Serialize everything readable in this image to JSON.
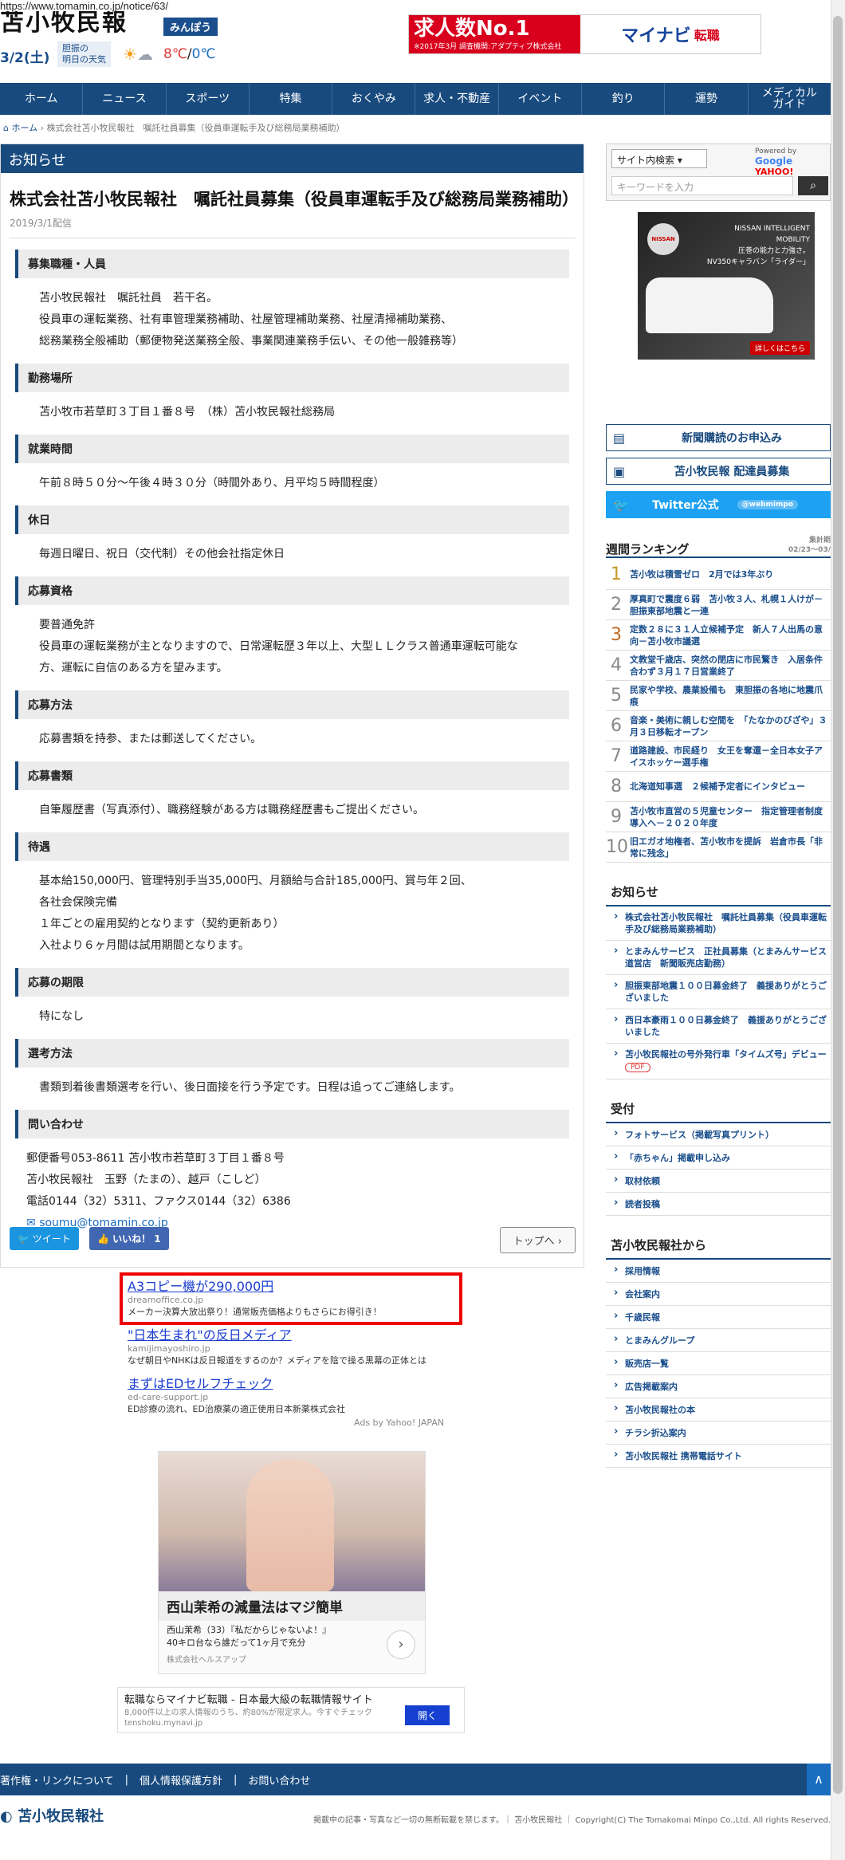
{
  "url": "https://www.tomamin.co.jp/notice/63/",
  "header": {
    "logo": "苫小牧民報",
    "minpo_badge": "みんぽう",
    "date": "3/2(土)",
    "weather_label": "胆振の\n明日の天気",
    "temp_high": "8℃",
    "temp_sep": "/",
    "temp_low": "0℃",
    "banner_main": "求人数No.1",
    "banner_sub": "※2017年3月 調査機関:アダプティブ株式会社",
    "banner_brand": "マイナビ",
    "banner_brand_suffix": "転職"
  },
  "nav": [
    "ホーム",
    "ニュース",
    "スポーツ",
    "特集",
    "おくやみ",
    "求人・不動産",
    "イベント",
    "釣り",
    "運勢",
    "メディカル\nガイド"
  ],
  "breadcrumb": {
    "home": "ホーム",
    "current": "株式会社苫小牧民報社　嘱託社員募集（役員車運転手及び総務局業務補助）"
  },
  "article": {
    "category": "お知らせ",
    "title": "株式会社苫小牧民報社　嘱託社員募集（役員車運転手及び総務局業務補助）",
    "date": "2019/3/1配信",
    "sections": [
      {
        "head": "募集職種・人員",
        "body": "苫小牧民報社　嘱託社員　若干名。\n役員車の運転業務、社有車管理業務補助、社屋管理補助業務、社屋清掃補助業務、\n総務業務全般補助（郵便物発送業務全般、事業関連業務手伝い、その他一般雑務等）"
      },
      {
        "head": "勤務場所",
        "body": "苫小牧市若草町３丁目１番８号　（株）苫小牧民報社総務局"
      },
      {
        "head": "就業時間",
        "body": "午前８時５０分～午後４時３０分（時間外あり、月平均５時間程度）"
      },
      {
        "head": "休日",
        "body": "毎週日曜日、祝日（交代制）その他会社指定休日"
      },
      {
        "head": "応募資格",
        "body": "要普通免許\n役員車の運転業務が主となりますので、日常運転歴３年以上、大型ＬＬクラス普通車運転可能な\n方、運転に自信のある方を望みます。"
      },
      {
        "head": "応募方法",
        "body": "応募書類を持参、または郵送してください。"
      },
      {
        "head": "応募書類",
        "body": "自筆履歴書（写真添付）、職務経験がある方は職務経歴書もご提出ください。"
      },
      {
        "head": "待遇",
        "body": "基本給150,000円、管理特別手当35,000円、月額給与合計185,000円、賞与年２回、\n各社会保険完備\n１年ごとの雇用契約となります（契約更新あり）\n入社より６ヶ月間は試用期間となります。"
      },
      {
        "head": "応募の期限",
        "body": "特になし"
      },
      {
        "head": "選考方法",
        "body": "書類到着後書類選考を行い、後日面接を行う予定です。日程は追ってご連絡します。"
      }
    ],
    "contact_head": "問い合わせ",
    "contact_lines": [
      "郵便番号053-8611 苫小牧市若草町３丁目１番８号",
      "苫小牧民報社　玉野（たまの）、越戸（こしど）",
      "電話0144（32）5311、ファクス0144（32）6386"
    ],
    "contact_email": "soumu@tomamin.co.jp",
    "tweet": "ツイート",
    "like": "いいね！ 1",
    "to_top": "トップへ"
  },
  "ads": [
    {
      "title": "A3コピー機が290,000円",
      "domain": "dreamoffice.co.jp",
      "desc": "メーカー決算大放出祭り！通常販売価格よりもさらにお得引き！"
    },
    {
      "title": "\"日本生まれ\"の反日メディア",
      "domain": "kamijimayoshiro.jp",
      "desc": "なぜ朝日やNHKは反日報道をするのか？メディアを陰で操る黒幕の正体とは"
    },
    {
      "title": "まずはEDセルフチェック",
      "domain": "ed-care-support.jp",
      "desc": "ED診療の流れ、ED治療薬の適正使用日本新薬株式会社"
    }
  ],
  "ads_by": "Ads by Yahoo! JAPAN",
  "image_ad": {
    "headline": "西山茉希の減量法はマジ簡単",
    "sub": "西山茉希（33）『私だからじゃないよ！』\n40キロ台なら誰だって1ヶ月で充分",
    "sponsor": "株式会社ヘルスアップ"
  },
  "mynavi_ad": {
    "title": "転職ならマイナビ転職 - 日本最大級の転職情報サイト",
    "desc": "8,000件以上の求人情報のうち、約80%が限定求人。今すぐチェック tenshoku.mynavi.jp",
    "button": "開く"
  },
  "sidebar": {
    "search_select": "サイト内検索",
    "powered_by": "Powered by",
    "powered_google": "Google",
    "powered_yahoo": "YAHOO!",
    "search_placeholder": "キーワードを入力",
    "car_ad": {
      "brand": "NISSAN",
      "text": "NISSAN INTELLIGENT MOBILITY\n圧巻の能力と力強さ。\nNV350キャラバン「ライダー」",
      "button": "詳しくはこちら"
    },
    "buttons": [
      {
        "label": "新聞購読のお申込み"
      },
      {
        "label": "苫小牧民報 配達員募集"
      },
      {
        "label": "Twitter公式",
        "tag": "@webmimpo"
      }
    ],
    "ranking_title": "週間ランキング",
    "ranking_period": "集計期\n02/23〜03/",
    "ranking": [
      "苫小牧は積雪ゼロ　2月では3年ぶり",
      "厚真町で震度６弱　苫小牧３人、札幌１人けが－胆振東部地震と一連",
      "定数２８に３１人立候補予定　新人７人出馬の意向－苫小牧市議選",
      "文教堂千歳店、突然の閉店に市民驚き　入居条件合わず３月１７日営業終了",
      "民家や学校、農業設備も　東胆振の各地に地震爪痕",
      "音楽・美術に親しむ空間を　「たなかのびざや」３月３日移転オープン",
      "道路建設、市民経り　女王を奪還－全日本女子アイスホッケー選手権",
      "北海道知事選　２候補予定者にインタビュー",
      "苫小牧市直営の５児童センター　指定管理者制度導入へ－２０２０年度",
      "旧エガオ地権者、苫小牧市を提訴　岩倉市長「非常に残念」"
    ],
    "notice_title": "お知らせ",
    "notices": [
      "株式会社苫小牧民報社　嘱託社員募集（役員車運転手及び総務局業務補助）",
      "とまみんサービス　正社員募集（とまみんサービス道営店　新聞販売店勤務）",
      "胆振東部地震１００日募金終了　義援ありがとうございました",
      "西日本豪雨１００日募金終了　義援ありがとうございました",
      "苫小牧民報社の号外発行車「タイムズ号」デビュー"
    ],
    "pdf": "PDF",
    "uketsuke_title": "受付",
    "uketsuke": [
      "フォトサービス（掲載写真プリント）",
      "「赤ちゃん」掲載申し込み",
      "取材依頼",
      "読者投稿"
    ],
    "from_title": "苫小牧民報社から",
    "from": [
      "採用情報",
      "会社案内",
      "千歳民報",
      "とまみんグループ",
      "販売店一覧",
      "広告掲載案内",
      "苫小牧民報社の本",
      "チラシ折込案内",
      "苫小牧民報社 携帯電話サイト"
    ]
  },
  "footer": {
    "links": [
      "著作権・リンクについて",
      "個人情報保護方針",
      "お問い合わせ"
    ],
    "pagetop": "∧",
    "logo": "苫小牧民報社",
    "copy": "掲載中の記事・写真など一切の無断転載を禁じます。｜ 苫小牧民報社 ｜ Copyright(C) The Tomakomai Minpo Co.,Ltd. All rights Reserved."
  }
}
